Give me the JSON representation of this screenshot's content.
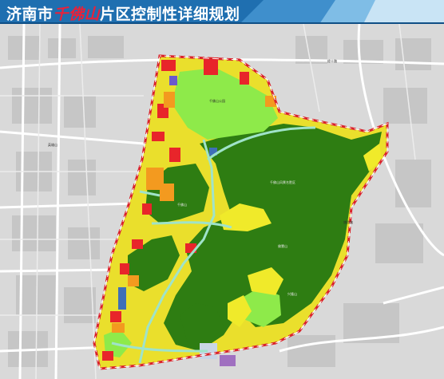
{
  "header": {
    "title_prefix": "济南市",
    "title_highlight": "千佛山",
    "title_suffix": "片区控制性详细规划"
  },
  "colors": {
    "header_blue": "#1f6fb0",
    "forest": "#2e7d12",
    "residential": "#f0ea2a",
    "commercial": "#e8252a",
    "park": "#8eea4a",
    "education": "#f39a1f",
    "boundary": "#d9232a",
    "road": "#9fe3c9",
    "basemap": "#d6d6d6"
  },
  "map": {
    "labels": [
      "千佛山",
      "千佛山风景名胜区",
      "千佛山公园",
      "佛慧山",
      "兴隆山",
      "英雄山",
      "旅游路",
      "经十路"
    ]
  }
}
